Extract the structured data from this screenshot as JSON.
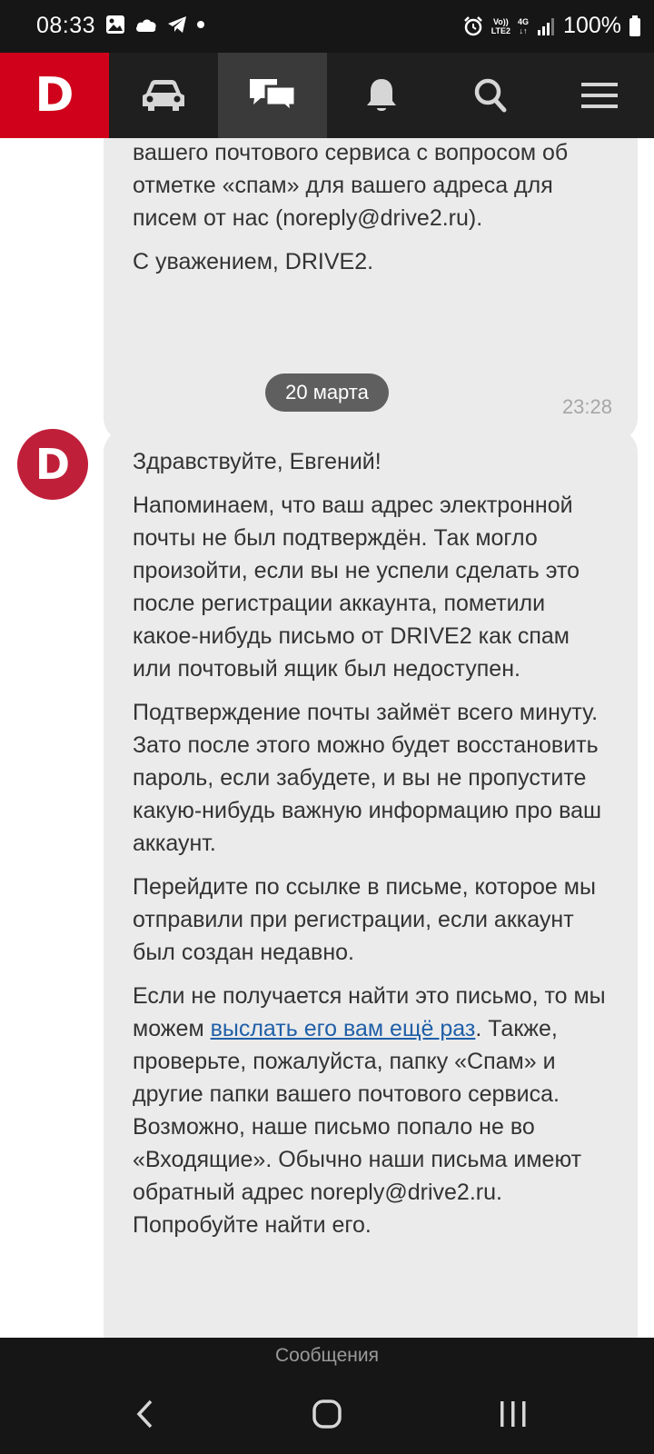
{
  "status_bar": {
    "time": "08:33",
    "battery": "100%",
    "network_top": "Vo))",
    "network_bottom": "LTE2",
    "network_type": "4G"
  },
  "nav": {
    "logo_letter": "D",
    "items": [
      "logo",
      "car-icon",
      "messages-icon",
      "bell-icon",
      "search-icon",
      "menu-icon"
    ],
    "active": "messages-icon",
    "brand_color": "#d0021b"
  },
  "messages": {
    "first": {
      "lines": [
        "вашего почтового сервиса с вопросом об отметке «спам» для вашего адреса для писем от нас (noreply@drive2.ru).",
        "С уважением, DRIVE2."
      ],
      "time": "23:28"
    },
    "date_separator": "20 марта",
    "sender_avatar_letter": "D",
    "second": {
      "greeting": "Здравствуйте, Евгений!",
      "p1": "Напоминаем, что ваш адрес электронной почты не был подтверждён. Так могло произойти, если вы не успели сделать это после регистрации аккаунта, пометили какое-нибудь письмо от DRIVE2 как спам или почтовый ящик был недоступен.",
      "p2": "Подтверждение почты займёт всего минуту. Зато после этого можно будет восстановить пароль, если забудете, и вы не пропустите какую-нибудь важную информацию про ваш аккаунт.",
      "p3": "Перейдите по ссылке в письме, которое мы отправили при регистрации, если аккаунт был создан недавно.",
      "p4_before": "Если не получается найти это письмо, то мы можем ",
      "p4_link": "выслать его вам ещё раз",
      "p4_after": ". Также, проверьте, пожалуйста, папку «Спам» и другие папки вашего почтового сервиса. Возможно, наше письмо попало не во «Входящие». Обычно наши письма имеют обратный адрес noreply@drive2.ru. Попробуйте найти его."
    }
  },
  "bottom_label": "Сообщения"
}
